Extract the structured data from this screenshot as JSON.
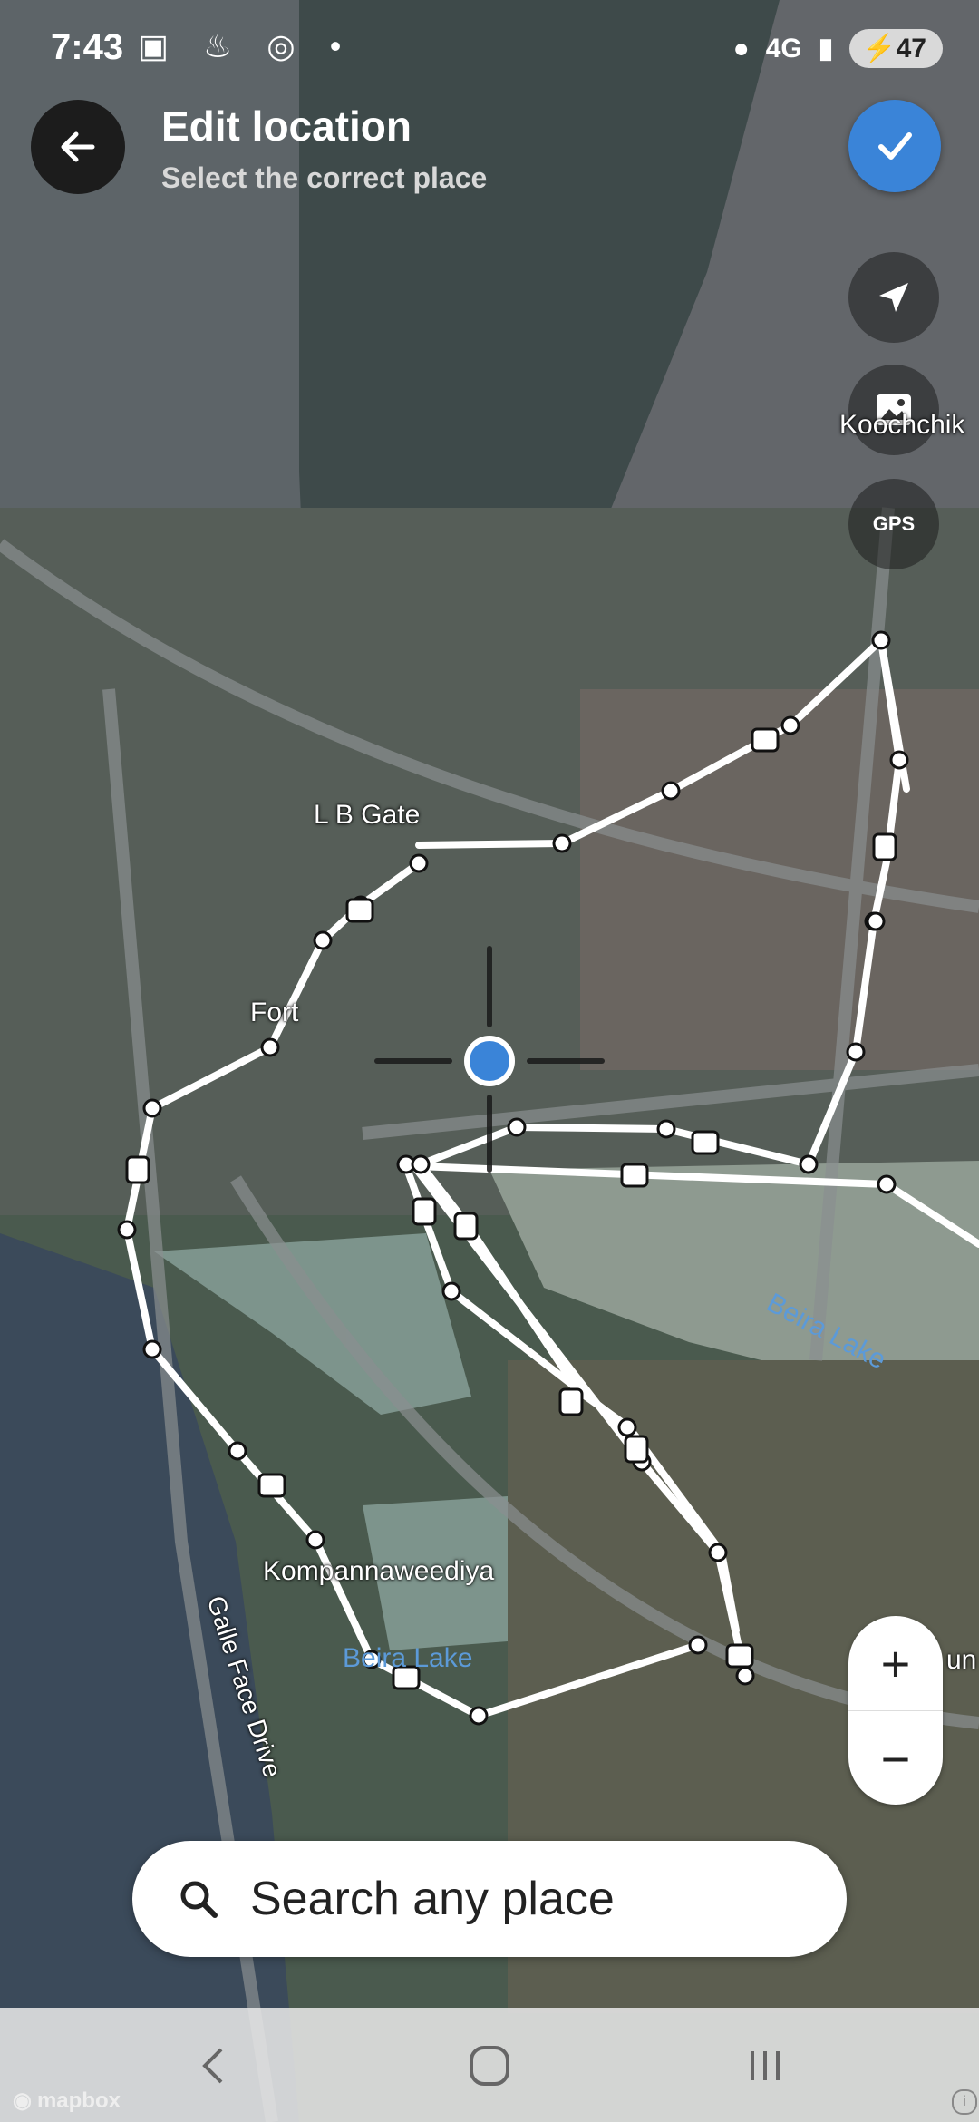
{
  "status_bar": {
    "time": "7:43",
    "network": "4G",
    "battery": "47"
  },
  "header": {
    "title": "Edit location",
    "subtitle": "Select the correct place"
  },
  "controls": {
    "gps_label": "GPS",
    "zoom_in": "+",
    "zoom_out": "−"
  },
  "map_labels": {
    "koochchikade": "Koochchik",
    "lb_gate": "L B Gate",
    "fort": "Fort",
    "beira_lake_east": "Beira Lake",
    "kompannaweediya": "Kompannaweediya",
    "beira_lake_south": "Beira Lake",
    "galle_face_drive": "Galle Face Drive",
    "cut_off": "un"
  },
  "search": {
    "placeholder": "Search any place"
  },
  "attribution": {
    "brand": "mapbox",
    "info": "i"
  },
  "colors": {
    "accent": "#3a84d8",
    "route": "#ffffff",
    "water": "#5c9ad8"
  }
}
